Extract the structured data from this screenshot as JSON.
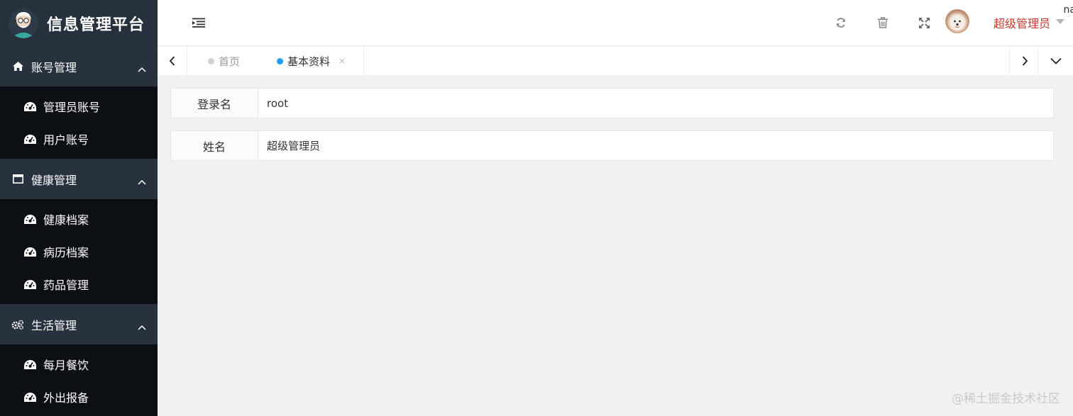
{
  "app": {
    "title": "信息管理平台"
  },
  "sidebar": {
    "groups": [
      {
        "label": "账号管理",
        "icon": "home-icon",
        "items": [
          {
            "label": "管理员账号"
          },
          {
            "label": "用户账号"
          }
        ]
      },
      {
        "label": "健康管理",
        "icon": "window-icon",
        "items": [
          {
            "label": "健康档案"
          },
          {
            "label": "病历档案"
          },
          {
            "label": "药品管理"
          }
        ]
      },
      {
        "label": "生活管理",
        "icon": "gears-icon",
        "items": [
          {
            "label": "每月餐饮"
          },
          {
            "label": "外出报备"
          }
        ]
      }
    ]
  },
  "header": {
    "user_name": "超级管理员",
    "clipped_text": "na"
  },
  "tabs": [
    {
      "label": "首页",
      "active": false
    },
    {
      "label": "基本资料",
      "active": true,
      "close": "×"
    }
  ],
  "profile": {
    "fields": [
      {
        "label": "登录名",
        "value": "root"
      },
      {
        "label": "姓名",
        "value": "超级管理员"
      }
    ]
  },
  "watermark": "@稀土掘金技术社区",
  "colors": {
    "sidebar_bg": "#0c0f14",
    "group_bg": "#28323e",
    "accent_dot": "#1e9fff",
    "user_name": "#c0392b"
  }
}
